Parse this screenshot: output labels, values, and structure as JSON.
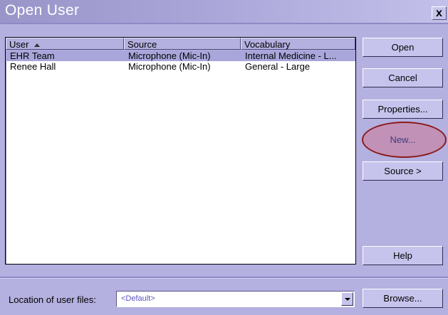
{
  "window": {
    "title": "Open User",
    "close_label": "x"
  },
  "list": {
    "columns": [
      {
        "label": "User",
        "sort": "ascending"
      },
      {
        "label": "Source"
      },
      {
        "label": "Vocabulary"
      }
    ],
    "rows": [
      {
        "user": "EHR Team",
        "source": "Microphone (Mic-In)",
        "vocabulary": "Internal Medicine - L...",
        "selected": true
      },
      {
        "user": "Renee Hall",
        "source": "Microphone (Mic-In)",
        "vocabulary": "General - Large",
        "selected": false
      }
    ]
  },
  "buttons": {
    "open": "Open",
    "cancel": "Cancel",
    "properties": "Properties...",
    "new": "New...",
    "source": "Source >",
    "help": "Help",
    "browse": "Browse..."
  },
  "location": {
    "label": "Location of user files:",
    "value": "<Default>"
  },
  "colors": {
    "background": "#b4b0e0",
    "selection": "#a9a6db",
    "highlight_ellipse": "#8b1a1a"
  }
}
